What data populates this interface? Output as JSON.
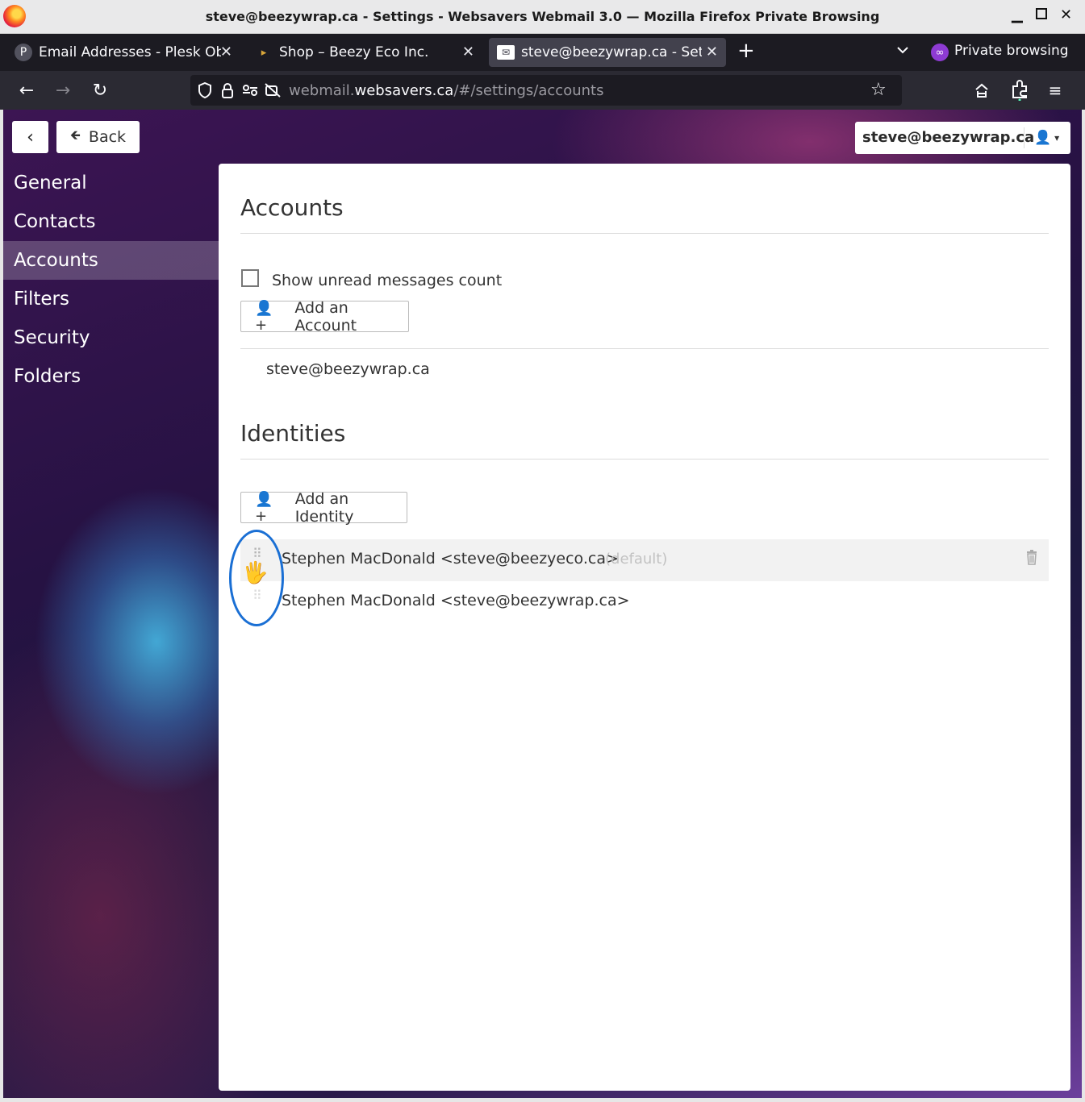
{
  "window": {
    "title": "steve@beezywrap.ca - Settings - Websavers Webmail 3.0 — Mozilla Firefox Private Browsing",
    "minimize_glyph": "▁",
    "close_glyph": "✕"
  },
  "tabs": [
    {
      "label": "Email Addresses - Plesk Obsidian",
      "icon": "P",
      "close": "✕"
    },
    {
      "label": "Shop – Beezy Eco Inc.",
      "icon": "▸",
      "close": "✕"
    },
    {
      "label": "steve@beezywrap.ca - Settings",
      "icon": "✉",
      "close": "✕"
    }
  ],
  "tabstrip": {
    "new_tab_glyph": "+",
    "private_icon": "∞",
    "private_label": "Private browsing"
  },
  "navbar": {
    "back_glyph": "←",
    "forward_glyph": "→",
    "reload_glyph": "↻",
    "url_prefix": "webmail.",
    "url_host": "websavers.ca",
    "url_path": "/#/settings/accounts",
    "star_glyph": "☆",
    "menu_glyph": "≡"
  },
  "app": {
    "prev_glyph": "‹",
    "back_arrow": "🡸",
    "back_label": "Back",
    "user_email": "steve@beezywrap.ca",
    "user_icon": "👤",
    "user_caret": "▾"
  },
  "sidebar": {
    "items": [
      {
        "label": "General",
        "active": false
      },
      {
        "label": "Contacts",
        "active": false
      },
      {
        "label": "Accounts",
        "active": true
      },
      {
        "label": "Filters",
        "active": false
      },
      {
        "label": "Security",
        "active": false
      },
      {
        "label": "Folders",
        "active": false
      }
    ]
  },
  "accounts": {
    "title": "Accounts",
    "show_unread_label": "Show unread messages count",
    "show_unread_checked": false,
    "add_account_label": "Add an Account",
    "add_icon": "👤+",
    "list": [
      "steve@beezywrap.ca"
    ]
  },
  "identities": {
    "title": "Identities",
    "add_identity_label": "Add an Identity",
    "drag_glyph": "⠿",
    "list": [
      {
        "label": "Stephen MacDonald <steve@beezyeco.ca>",
        "tag": "(default)"
      },
      {
        "label": "Stephen MacDonald <steve@beezywrap.ca>",
        "tag": ""
      }
    ]
  },
  "cursor_glyph": "🖐",
  "colors": {
    "accent": "#1a6fd4",
    "tab_active": "#42414d",
    "chrome_dark": "#1c1b22",
    "private_purple": "#8e3bd3"
  }
}
